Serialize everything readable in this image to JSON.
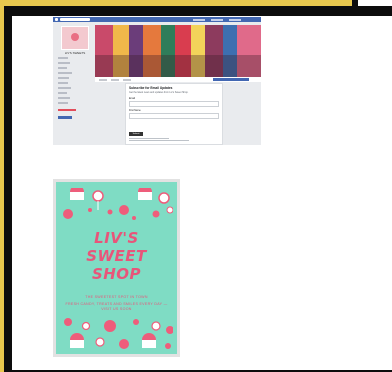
{
  "facebook_page": {
    "page_name": "LIV'S SWEETS",
    "form_title": "Subscribe for Email Updates",
    "form_description": "Get the latest news and updates from Liv's Sweet Shop.",
    "email_label": "Email",
    "first_name_label": "First Name",
    "submit_label": "Submit",
    "accent": "#4267b2"
  },
  "poster": {
    "title_line1": "LIV'S",
    "title_line2": "SWEET",
    "title_line3": "SHOP",
    "tagline": "THE SWEETEST SPOT IN TOWN",
    "body": "FRESH CANDY, TREATS AND SMILES EVERY DAY — VISIT US SOON",
    "background": "#7fdcc4",
    "accent": "#e8557a"
  }
}
